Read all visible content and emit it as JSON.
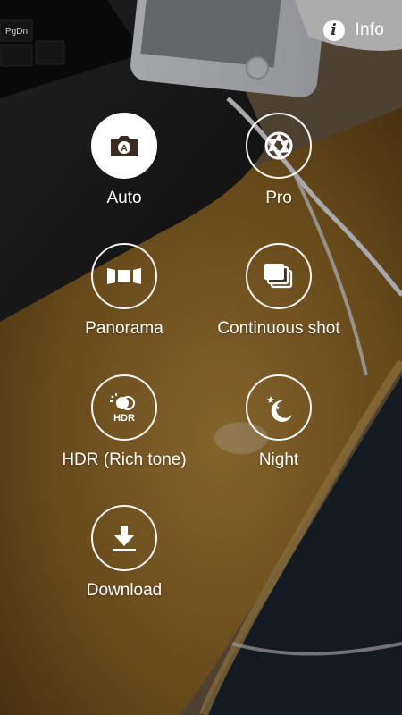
{
  "header": {
    "info_icon_glyph": "i",
    "info_label": "Info"
  },
  "keyboard": {
    "key_label": "PgDn"
  },
  "modes": [
    {
      "id": "auto",
      "label": "Auto",
      "icon": "camera-auto-icon",
      "selected": true
    },
    {
      "id": "pro",
      "label": "Pro",
      "icon": "aperture-icon",
      "selected": false
    },
    {
      "id": "panorama",
      "label": "Panorama",
      "icon": "panorama-icon",
      "selected": false
    },
    {
      "id": "continuous",
      "label": "Continuous shot",
      "icon": "continuous-shot-icon",
      "selected": false
    },
    {
      "id": "hdr",
      "label": "HDR (Rich tone)",
      "icon": "hdr-icon",
      "icon_text": "HDR",
      "selected": false
    },
    {
      "id": "night",
      "label": "Night",
      "icon": "night-moon-icon",
      "selected": false
    },
    {
      "id": "download",
      "label": "Download",
      "icon": "download-icon",
      "selected": false
    }
  ],
  "colors": {
    "accent_selected_bg": "#ffffff",
    "ring": "#ffffff",
    "icon_on_selected": "#3a2d1f"
  }
}
